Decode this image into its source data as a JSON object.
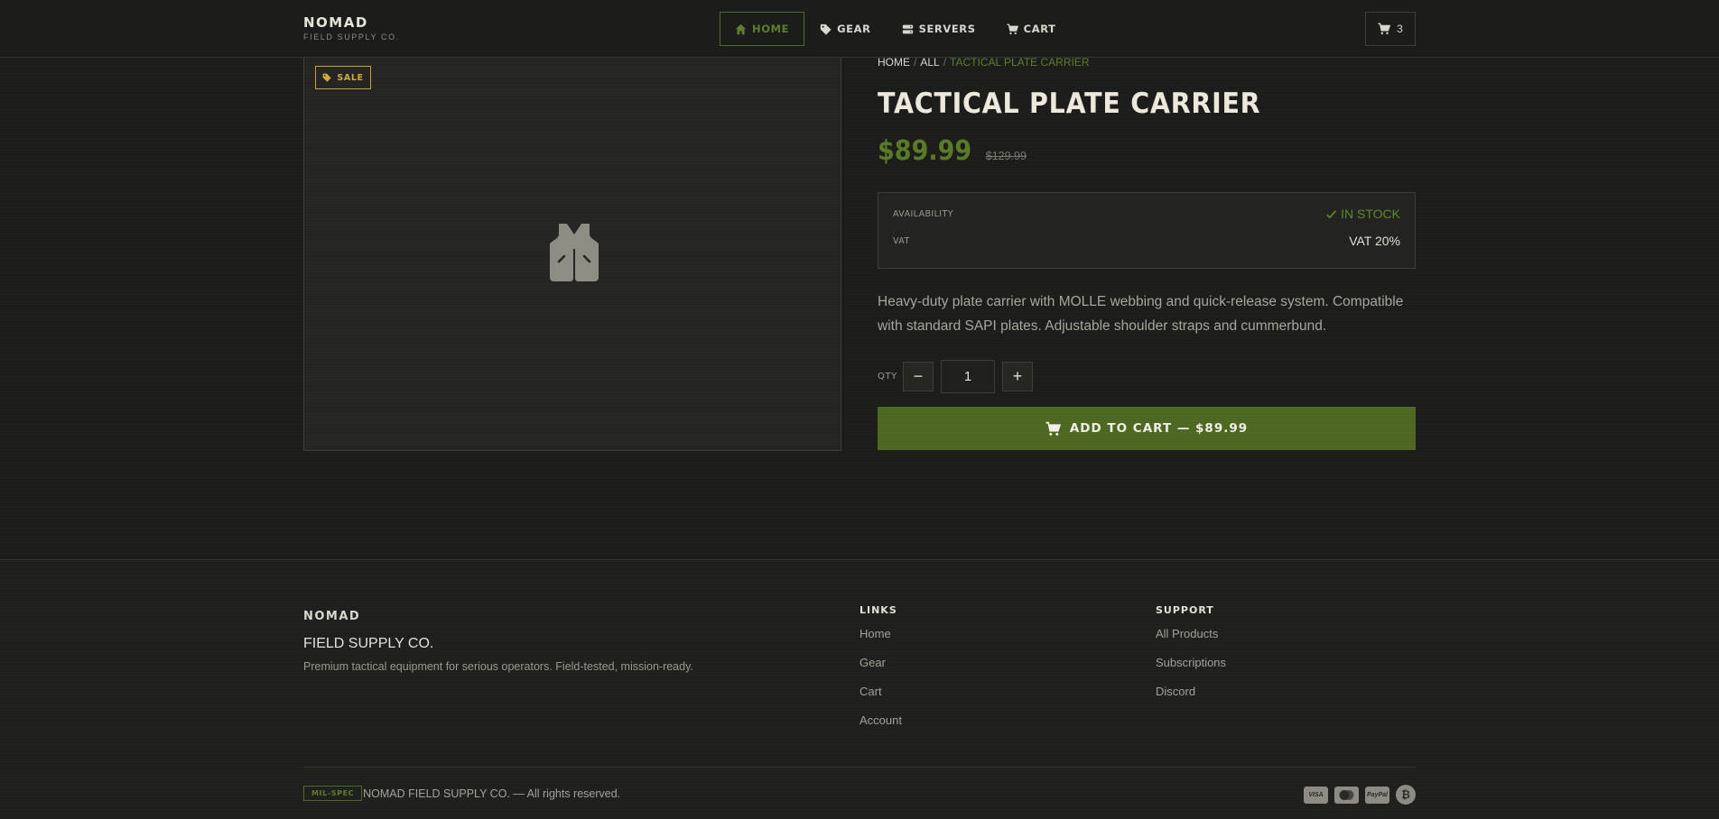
{
  "brand": {
    "name": "NOMAD",
    "sub": "FIELD SUPPLY CO."
  },
  "nav": {
    "items": [
      {
        "label": "HOME",
        "icon": "home-icon",
        "active": true
      },
      {
        "label": "GEAR",
        "icon": "tag-icon"
      },
      {
        "label": "SERVERS",
        "icon": "server-icon"
      },
      {
        "label": "CART",
        "icon": "cart-icon"
      }
    ],
    "cart_count": "3"
  },
  "product": {
    "badge": "SALE",
    "image_icon": "vest-icon",
    "breadcrumb": {
      "home": "HOME",
      "sep": "/",
      "all": "ALL",
      "current": "TACTICAL PLATE CARRIER"
    },
    "title": "TACTICAL PLATE CARRIER",
    "price": "$89.99",
    "old_price": "$129.99",
    "specs": {
      "availability_label": "AVAILABILITY",
      "availability_value": "IN STOCK",
      "vat_label": "VAT",
      "vat_value": "VAT 20%"
    },
    "description": "Heavy-duty plate carrier with MOLLE webbing and quick-release system. Compatible with standard SAPI plates. Adjustable shoulder straps and cummerbund.",
    "qty_label": "QTY",
    "qty_value": "1",
    "qty_minus": "−",
    "qty_plus": "+",
    "add_to_cart": "ADD TO CART — $89.99"
  },
  "footer": {
    "brand": "NOMAD",
    "sub": "FIELD SUPPLY CO.",
    "tagline": "Premium tactical equipment for serious operators. Field-tested, mission-ready.",
    "links_title": "LINKS",
    "links": [
      "Home",
      "Gear",
      "Cart",
      "Account"
    ],
    "support_title": "SUPPORT",
    "support": [
      "All Products",
      "Subscriptions",
      "Discord"
    ],
    "milspec": "MIL-SPEC",
    "copyright": "NOMAD FIELD SUPPLY CO. — All rights reserved.",
    "payments": [
      "VISA",
      "mastercard",
      "PayPal",
      "₿"
    ]
  },
  "colors": {
    "accent": "#5a7a27",
    "sale": "#c8a03a",
    "background": "#1c1d1b",
    "button": "#4f6a22"
  }
}
